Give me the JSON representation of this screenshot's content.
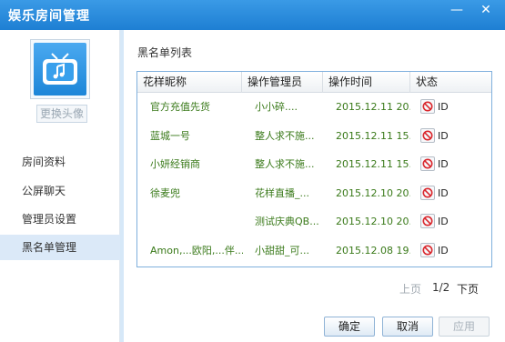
{
  "window": {
    "title": "娱乐房间管理",
    "minimize_glyph": "—",
    "close_glyph": "✕"
  },
  "sidebar": {
    "avatar_icon": "tv-music-icon",
    "change_avatar_label": "更换头像",
    "items": [
      {
        "label": "房间资料",
        "active": false
      },
      {
        "label": "公屏聊天",
        "active": false
      },
      {
        "label": "管理员设置",
        "active": false
      },
      {
        "label": "黑名单管理",
        "active": true
      }
    ]
  },
  "main": {
    "section_title": "黑名单列表",
    "columns": [
      "花样昵称",
      "操作管理员",
      "操作时间",
      "状态"
    ],
    "rows": [
      {
        "name": "官方充值先货",
        "admin": "小小碎....",
        "time": "2015.12.11 20...",
        "status": "ID"
      },
      {
        "name": "蓝城一号",
        "admin": "整人求不施...",
        "time": "2015.12.11 15...",
        "status": "ID"
      },
      {
        "name": "小妍经销商",
        "admin": "整人求不施...",
        "time": "2015.12.11 15...",
        "status": "ID"
      },
      {
        "name": "徐麦兜",
        "admin": "花样直播_...",
        "time": "2015.12.10 20...",
        "status": "ID"
      },
      {
        "name": "",
        "admin": "测试庆典QB...",
        "time": "2015.12.10 20...",
        "status": "ID"
      },
      {
        "name": "Amon,...欧阳,...伴...",
        "admin": "小甜甜_可...",
        "time": "2015.12.08 19...",
        "status": "ID"
      }
    ],
    "pager": {
      "prev": "上页",
      "page": "1/2",
      "next": "下页"
    }
  },
  "footer": {
    "ok": "确定",
    "cancel": "取消",
    "apply": "应用"
  },
  "colors": {
    "titlebar": "#1e7fd3",
    "accent_green": "#3a7a1a",
    "active_nav": "#dbe9f8",
    "ban_red": "#d9262c"
  }
}
